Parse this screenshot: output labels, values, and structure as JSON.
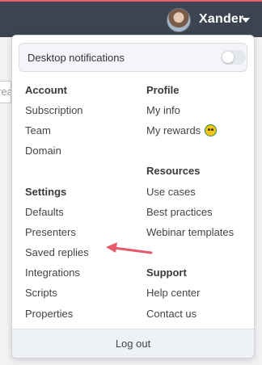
{
  "header": {
    "username": "Xander"
  },
  "background": {
    "partial_text": "rea"
  },
  "menu": {
    "notifications": {
      "label": "Desktop notifications",
      "enabled": false
    },
    "left": [
      {
        "heading": "Account",
        "items": [
          "Subscription",
          "Team",
          "Domain"
        ]
      },
      {
        "heading": "Settings",
        "items": [
          "Defaults",
          "Presenters",
          "Saved replies",
          "Integrations",
          "Scripts",
          "Properties"
        ]
      }
    ],
    "right": [
      {
        "heading": "Profile",
        "items": [
          "My info",
          "My rewards"
        ]
      },
      {
        "heading": "Resources",
        "items": [
          "Use cases",
          "Best practices",
          "Webinar templates"
        ]
      },
      {
        "heading": "Support",
        "items": [
          "Help center",
          "Contact us"
        ]
      }
    ],
    "logout": "Log out"
  },
  "icons": {
    "avatar": "user-avatar",
    "caret": "caret-down-icon",
    "rewards": "rewards-badge-icon",
    "annotation": "red-arrow-icon"
  },
  "colors": {
    "topbar": "#3b4450",
    "accent_stripe": "#e8606b",
    "arrow": "#e85a6a"
  }
}
